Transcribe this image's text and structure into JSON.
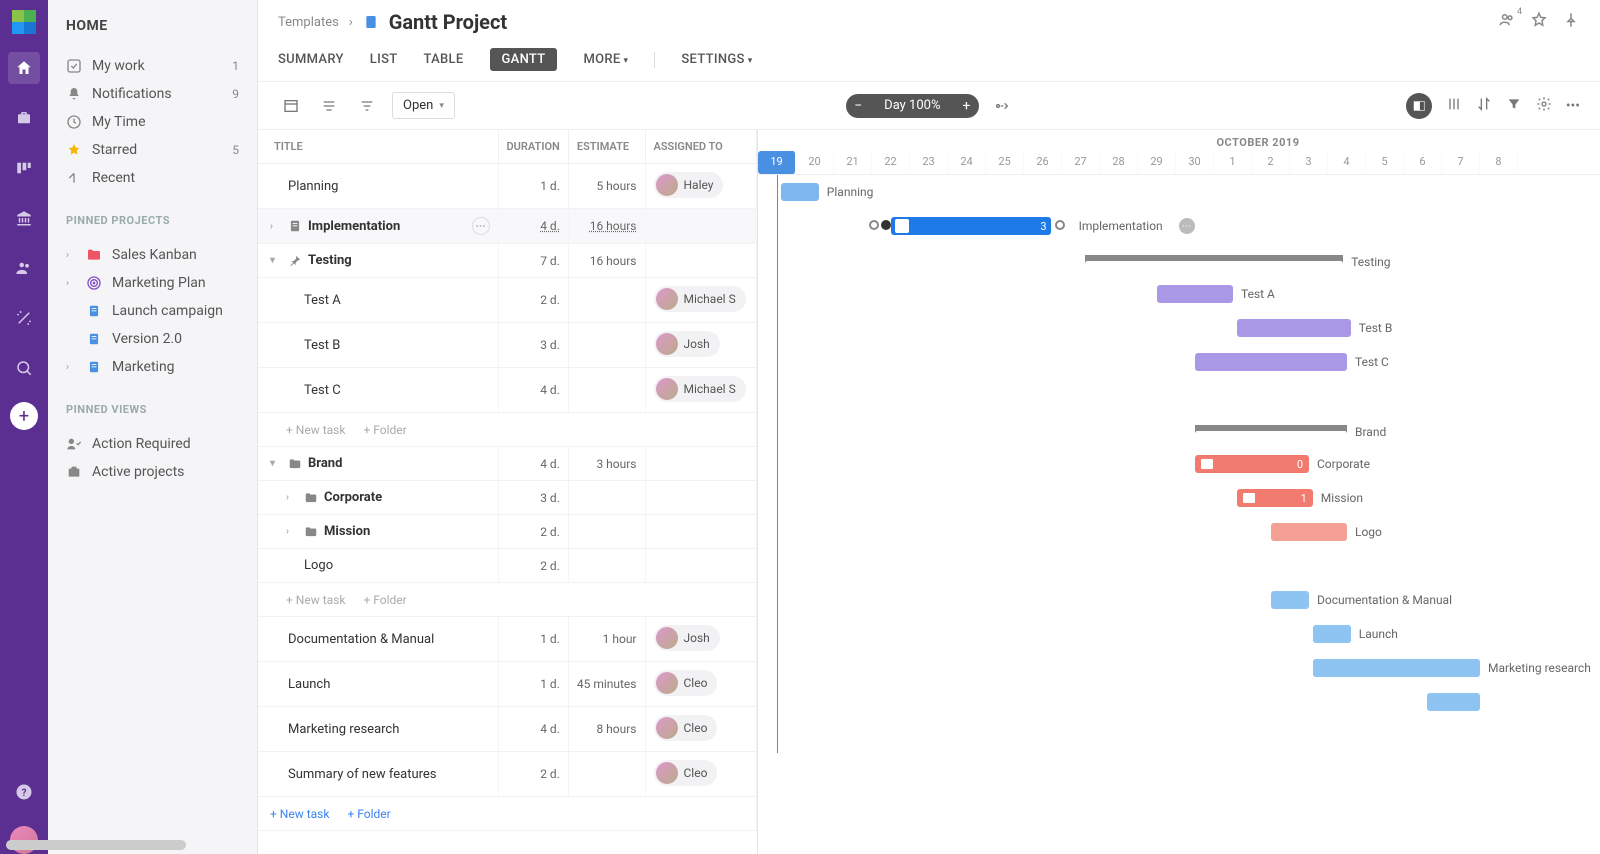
{
  "rail": {
    "user_badge": "4"
  },
  "sidebar": {
    "home": "HOME",
    "items": [
      {
        "icon": "check",
        "label": "My work",
        "badge": "1"
      },
      {
        "icon": "bell",
        "label": "Notifications",
        "badge": "9"
      },
      {
        "icon": "clock",
        "label": "My Time",
        "badge": ""
      },
      {
        "icon": "star",
        "label": "Starred",
        "badge": "5"
      },
      {
        "icon": "recent",
        "label": "Recent",
        "badge": ""
      }
    ],
    "pinned_projects_label": "PINNED PROJECTS",
    "pinned_projects": [
      {
        "icon": "folder-red",
        "label": "Sales Kanban",
        "chev": true
      },
      {
        "icon": "target",
        "label": "Marketing Plan",
        "chev": true
      },
      {
        "icon": "doc",
        "label": "Launch campaign",
        "chev": false
      },
      {
        "icon": "doc",
        "label": "Version 2.0",
        "chev": false
      },
      {
        "icon": "doc",
        "label": "Marketing",
        "chev": true
      }
    ],
    "pinned_views_label": "PINNED VIEWS",
    "pinned_views": [
      {
        "icon": "action",
        "label": "Action Required"
      },
      {
        "icon": "case",
        "label": "Active projects"
      }
    ]
  },
  "breadcrumb": {
    "root": "Templates",
    "title": "Gantt Project"
  },
  "tabs": {
    "summary": "SUMMARY",
    "list": "LIST",
    "table": "TABLE",
    "gantt": "GANTT",
    "more": "MORE",
    "settings": "SETTINGS"
  },
  "toolbar": {
    "open": "Open",
    "zoom": "Day 100%"
  },
  "grid": {
    "headers": {
      "title": "TITLE",
      "duration": "DURATION",
      "estimate": "ESTIMATE",
      "assigned": "ASSIGNED TO"
    },
    "new_task": "+ New task",
    "new_folder": "+ Folder",
    "rows": [
      {
        "type": "task",
        "indent": 0,
        "title": "Planning",
        "dur": "1 d.",
        "est": "5 hours",
        "assignee": "Haley"
      },
      {
        "type": "group",
        "indent": 0,
        "title": "Implementation",
        "icon": "doc",
        "dur": "4 d.",
        "est": "16 hours",
        "est_u": true,
        "sel": true,
        "chev": "right",
        "ellipsis": true
      },
      {
        "type": "group",
        "indent": 0,
        "title": "Testing",
        "icon": "pin",
        "dur": "7 d.",
        "est": "16 hours",
        "chev": "down"
      },
      {
        "type": "task",
        "indent": 1,
        "title": "Test A",
        "dur": "2 d.",
        "assignee": "Michael S"
      },
      {
        "type": "task",
        "indent": 1,
        "title": "Test B",
        "dur": "3 d.",
        "assignee": "Josh"
      },
      {
        "type": "task",
        "indent": 1,
        "title": "Test C",
        "dur": "4 d.",
        "assignee": "Michael S"
      },
      {
        "type": "new",
        "indent": 1
      },
      {
        "type": "group",
        "indent": 0,
        "title": "Brand",
        "icon": "folder",
        "dur": "4 d.",
        "est": "3 hours",
        "chev": "down"
      },
      {
        "type": "group",
        "indent": 1,
        "title": "Corporate",
        "icon": "folder",
        "dur": "3 d.",
        "chev": "right"
      },
      {
        "type": "group",
        "indent": 1,
        "title": "Mission",
        "icon": "folder",
        "dur": "2 d.",
        "chev": "right"
      },
      {
        "type": "task",
        "indent": 1,
        "title": "Logo",
        "dur": "2 d."
      },
      {
        "type": "new",
        "indent": 1
      },
      {
        "type": "task",
        "indent": 0,
        "title": "Documentation & Manual",
        "dur": "1 d.",
        "est": "1 hour",
        "assignee": "Josh"
      },
      {
        "type": "task",
        "indent": 0,
        "title": "Launch",
        "dur": "1 d.",
        "est": "45 minutes",
        "assignee": "Cleo"
      },
      {
        "type": "task",
        "indent": 0,
        "title": "Marketing research",
        "dur": "4 d.",
        "est": "8 hours",
        "assignee": "Cleo"
      },
      {
        "type": "task",
        "indent": 0,
        "title": "Summary of new features",
        "dur": "2 d.",
        "assignee": "Cleo"
      },
      {
        "type": "new",
        "indent": 0,
        "add_style": true
      }
    ]
  },
  "timeline": {
    "month": "OCTOBER 2019",
    "today": 19,
    "days": [
      19,
      20,
      21,
      22,
      23,
      24,
      25,
      26,
      27,
      28,
      29,
      30,
      1,
      2,
      3,
      4,
      5,
      6,
      7,
      8
    ],
    "bars": [
      {
        "row": 0,
        "start": 0.6,
        "span": 1.0,
        "cls": "blue",
        "label": "Planning"
      },
      {
        "row": 1,
        "start": 3.5,
        "span": 4.2,
        "cls": "solid-blue",
        "label": "Implementation",
        "badge": "3",
        "impl_extras": true
      },
      {
        "row": 2,
        "start": 8.6,
        "span": 6.8,
        "cls": "group-summary",
        "label": "Testing"
      },
      {
        "row": 3,
        "start": 10.5,
        "span": 2.0,
        "cls": "purple",
        "label": "Test A"
      },
      {
        "row": 4,
        "start": 12.6,
        "span": 3.0,
        "cls": "purple",
        "label": "Test B"
      },
      {
        "row": 5,
        "start": 11.5,
        "span": 4.0,
        "cls": "purple",
        "label": "Test C"
      },
      {
        "row": 7,
        "start": 11.5,
        "span": 4.0,
        "cls": "group-summary",
        "label": "Brand"
      },
      {
        "row": 8,
        "start": 11.5,
        "span": 3.0,
        "cls": "red",
        "label": "Corporate",
        "badge": "0",
        "folder": true
      },
      {
        "row": 9,
        "start": 12.6,
        "span": 2.0,
        "cls": "red",
        "label": "Mission",
        "badge": "1",
        "folder": true
      },
      {
        "row": 10,
        "start": 13.5,
        "span": 2.0,
        "cls": "red2",
        "label": "Logo"
      },
      {
        "row": 12,
        "start": 13.5,
        "span": 1.0,
        "cls": "sky",
        "label": "Documentation & Manual"
      },
      {
        "row": 13,
        "start": 14.6,
        "span": 1.0,
        "cls": "sky",
        "label": "Launch"
      },
      {
        "row": 14,
        "start": 14.6,
        "span": 4.4,
        "cls": "sky",
        "label": "Marketing research",
        "clip": true
      },
      {
        "row": 15,
        "start": 17.6,
        "span": 1.4,
        "cls": "sky",
        "clip": true
      }
    ]
  }
}
